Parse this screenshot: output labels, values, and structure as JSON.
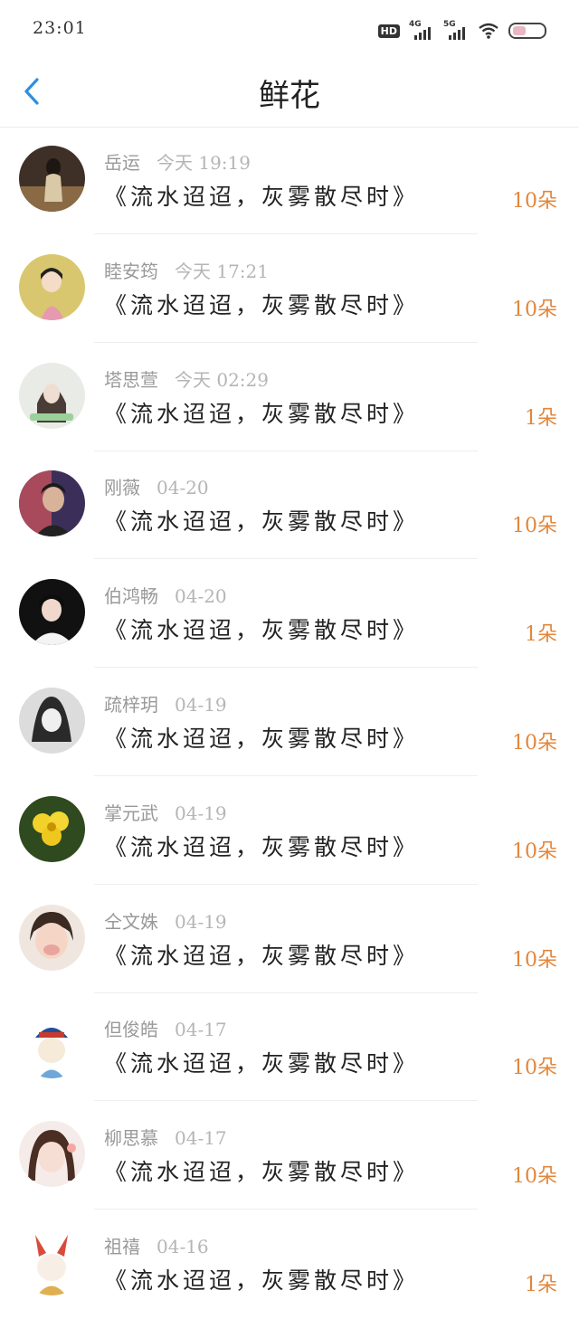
{
  "status": {
    "time": "23:01",
    "hd": "HD",
    "net1": "4G",
    "net2": "5G"
  },
  "header": {
    "title": "鲜花"
  },
  "list": [
    {
      "name": "岳运",
      "time": "今天 19:19",
      "message": "《流水迢迢，灰雾散尽时》",
      "count": "10朵"
    },
    {
      "name": "睦安筠",
      "time": "今天 17:21",
      "message": "《流水迢迢，灰雾散尽时》",
      "count": "10朵"
    },
    {
      "name": "塔思萱",
      "time": "今天 02:29",
      "message": "《流水迢迢，灰雾散尽时》",
      "count": "1朵"
    },
    {
      "name": "刚薇",
      "time": "04-20",
      "message": "《流水迢迢，灰雾散尽时》",
      "count": "10朵"
    },
    {
      "name": "伯鸿畅",
      "time": "04-20",
      "message": "《流水迢迢，灰雾散尽时》",
      "count": "1朵"
    },
    {
      "name": "疏梓玥",
      "time": "04-19",
      "message": "《流水迢迢，灰雾散尽时》",
      "count": "10朵"
    },
    {
      "name": "掌元武",
      "time": "04-19",
      "message": "《流水迢迢，灰雾散尽时》",
      "count": "10朵"
    },
    {
      "name": "仝文姝",
      "time": "04-19",
      "message": "《流水迢迢，灰雾散尽时》",
      "count": "10朵"
    },
    {
      "name": "但俊皓",
      "time": "04-17",
      "message": "《流水迢迢，灰雾散尽时》",
      "count": "10朵"
    },
    {
      "name": "柳思慕",
      "time": "04-17",
      "message": "《流水迢迢，灰雾散尽时》",
      "count": "10朵"
    },
    {
      "name": "祖禧",
      "time": "04-16",
      "message": "《流水迢迢，灰雾散尽时》",
      "count": "1朵"
    }
  ],
  "colors": {
    "accent": "#e3863b",
    "back": "#2f8fe0",
    "muted": "#999999"
  },
  "icons": {
    "back": "chevron-left-icon",
    "wifi": "wifi-icon",
    "battery": "battery-icon"
  }
}
